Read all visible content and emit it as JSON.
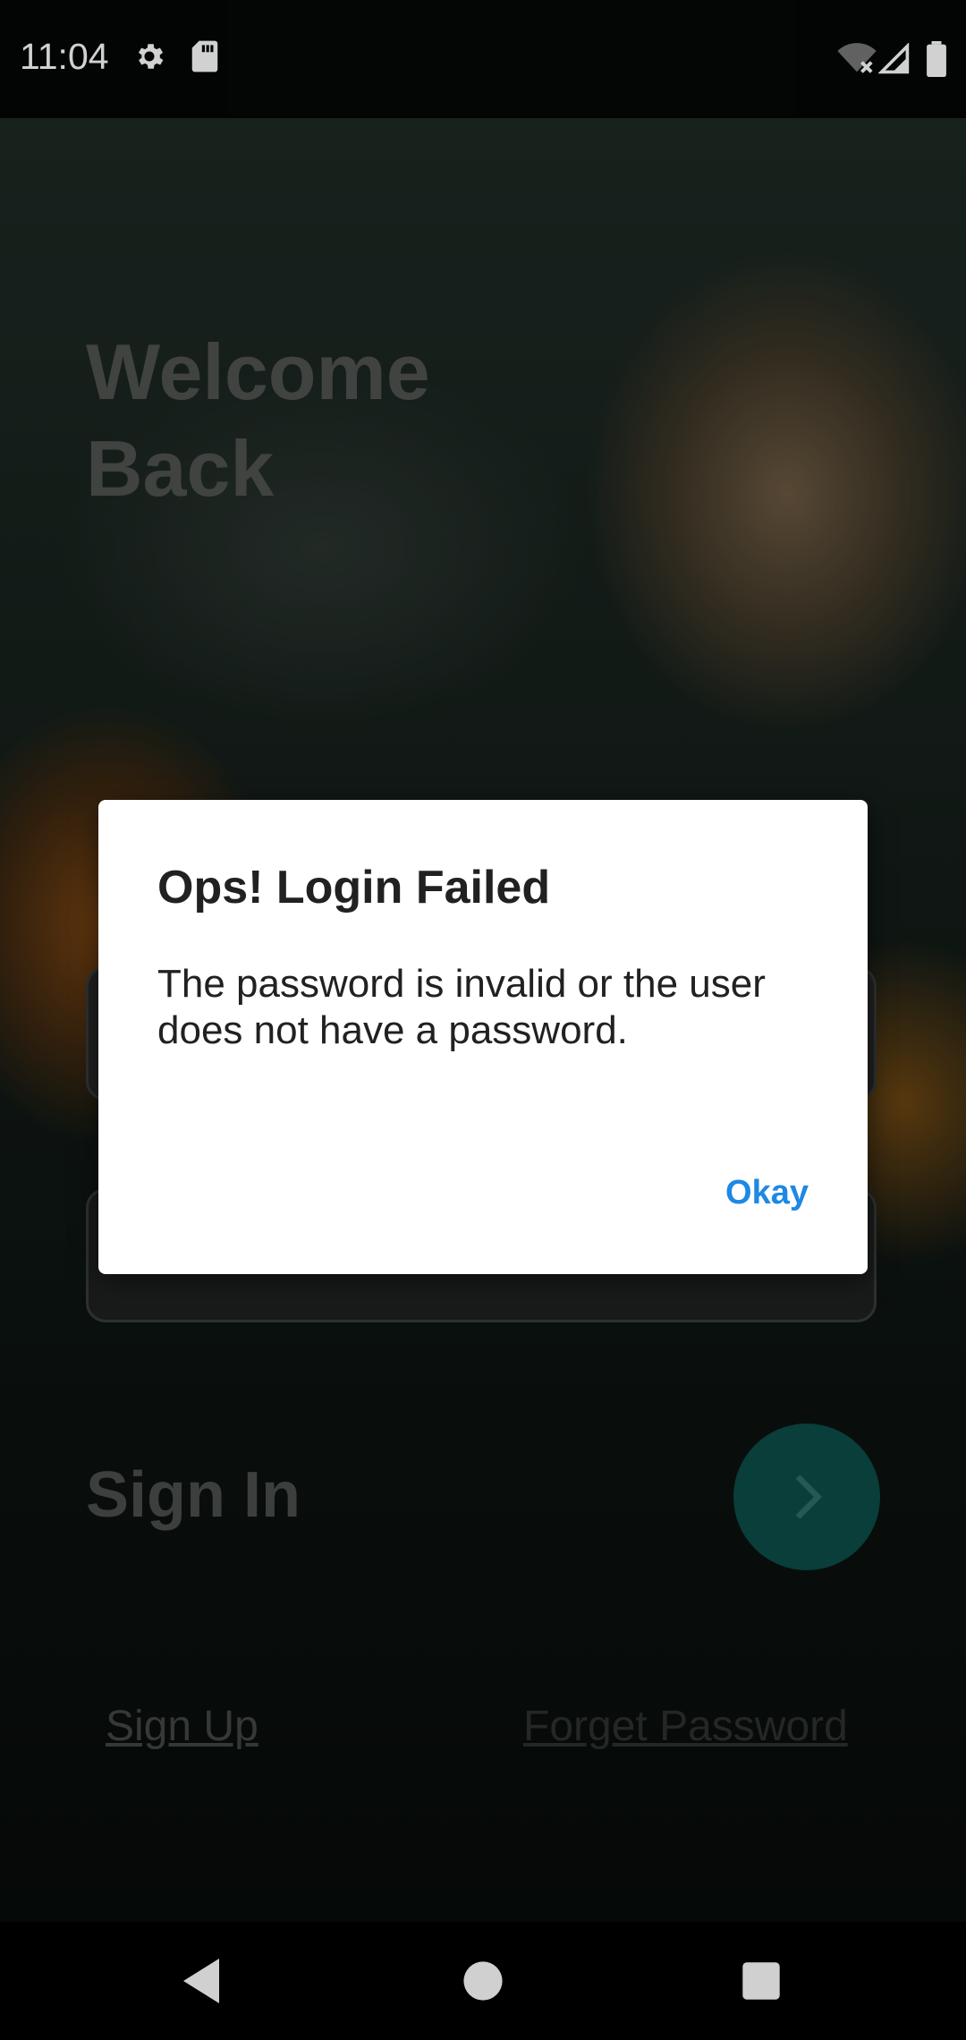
{
  "status_bar": {
    "time": "11:04",
    "icons": [
      "gear-icon",
      "sd-card-icon",
      "wifi-off-icon",
      "signal-icon",
      "battery-icon"
    ]
  },
  "screen": {
    "welcome_title": "Welcome Back",
    "sign_in_label": "Sign In",
    "sign_up_link": "Sign Up",
    "forget_password_link": "Forget Password"
  },
  "dialog": {
    "title": "Ops! Login Failed",
    "message": "The password is invalid or the user does not have a password.",
    "okay_label": "Okay"
  },
  "colors": {
    "accent": "#1e88e5",
    "go_button": "#0b4c47"
  },
  "nav_bar": {
    "buttons": [
      "back-icon",
      "home-icon",
      "recents-icon"
    ]
  }
}
